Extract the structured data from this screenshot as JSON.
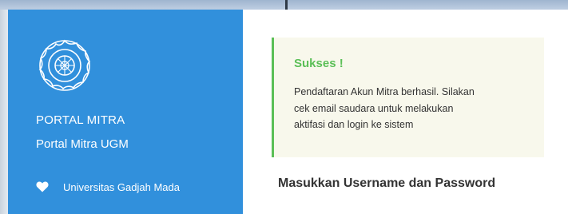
{
  "sidebar": {
    "logo_icon": "ugm-seal-icon",
    "title": "PORTAL MITRA",
    "subtitle": "Portal Mitra UGM",
    "footer_icon": "heart-icon",
    "footer_text": "Universitas Gadjah Mada",
    "background_color": "#3190dc"
  },
  "alert": {
    "title": "Sukses !",
    "lines": [
      "Pendaftaran Akun Mitra berhasil. Silakan",
      "cek email saudara untuk melakukan",
      "aktifasi dan login ke sistem"
    ],
    "accent_color": "#5bbf57",
    "background_color": "#f8f8ec"
  },
  "login": {
    "heading": "Masukkan Username dan Password"
  }
}
